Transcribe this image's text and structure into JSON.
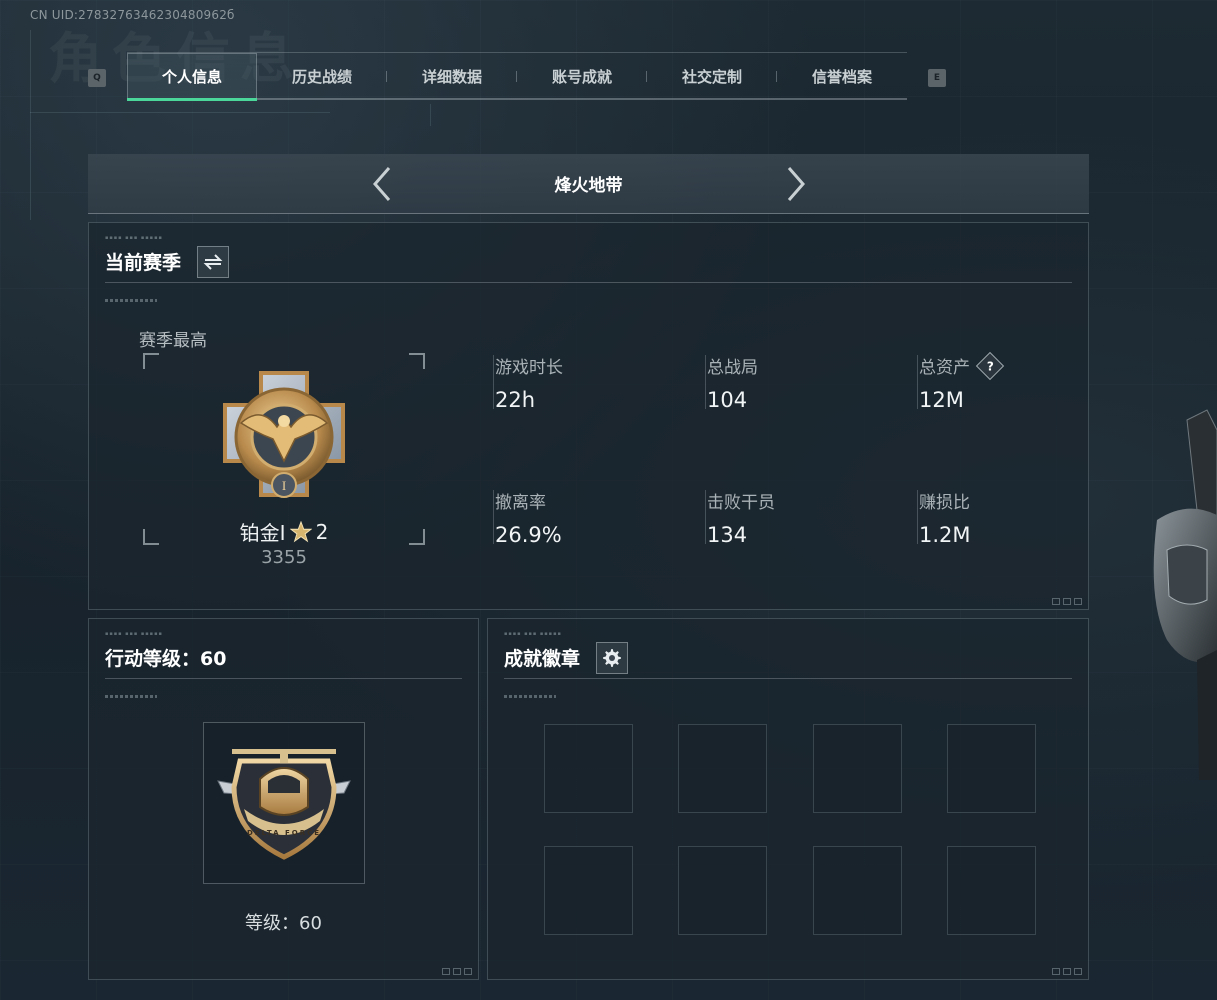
{
  "uid": "CN UID:2783276346230480962б",
  "watermark_text": "角色信息",
  "tabbar": {
    "prev_key": "Q",
    "next_key": "E",
    "tabs": [
      {
        "label": "个人信息",
        "active": true
      },
      {
        "label": "历史战绩",
        "active": false
      },
      {
        "label": "详细数据",
        "active": false
      },
      {
        "label": "账号成就",
        "active": false
      },
      {
        "label": "社交定制",
        "active": false
      },
      {
        "label": "信誉档案",
        "active": false
      }
    ]
  },
  "mode": {
    "title": "烽火地带"
  },
  "season": {
    "header": "当前赛季",
    "best_label": "赛季最高",
    "rank_name": "铂金Ⅰ",
    "rank_stars": "2",
    "rank_points": "3355",
    "stats": [
      {
        "label": "游戏时长",
        "value": "22h"
      },
      {
        "label": "总战局",
        "value": "104"
      },
      {
        "label": "总资产",
        "value": "12M",
        "help": "?"
      },
      {
        "label": "撤离率",
        "value": "26.9%"
      },
      {
        "label": "击败干员",
        "value": "134"
      },
      {
        "label": "赚损比",
        "value": "1.2M"
      }
    ]
  },
  "level": {
    "header": "行动等级：60",
    "badge_text": "DELTA FORCE",
    "level_text": "等级：60"
  },
  "badges": {
    "header": "成就徽章",
    "slot_count": 8
  },
  "colors": {
    "accent": "#4bd69a",
    "gold": "#c9a35f",
    "background": "#1b2730"
  }
}
